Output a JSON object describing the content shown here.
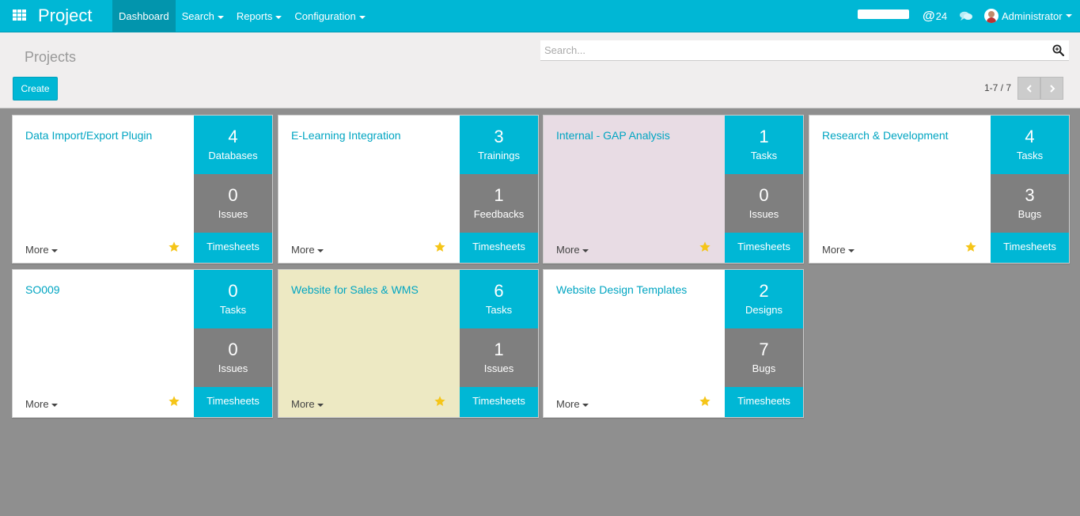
{
  "navbar": {
    "app_title": "Project",
    "menu": [
      {
        "label": "Dashboard",
        "dropdown": false,
        "active": true
      },
      {
        "label": "Search",
        "dropdown": true,
        "active": false
      },
      {
        "label": "Reports",
        "dropdown": true,
        "active": false
      },
      {
        "label": "Configuration",
        "dropdown": true,
        "active": false
      }
    ],
    "mentions_count": "24",
    "user_name": "Administrator"
  },
  "control_panel": {
    "breadcrumb": "Projects",
    "search_placeholder": "Search...",
    "create_label": "Create",
    "pager": "1-7 / 7"
  },
  "colors": {
    "brand": "#00b7d5",
    "secondary_stat": "#7f7f7f",
    "star": "#f5c518",
    "card_pink": "#e8dce4",
    "card_yellow": "#ede9c3"
  },
  "projects": [
    {
      "name": "Data Import/Export Plugin",
      "primary": {
        "value": "4",
        "label": "Databases"
      },
      "secondary": {
        "value": "0",
        "label": "Issues"
      },
      "more": "More",
      "timesheets": "Timesheets",
      "bg": "white"
    },
    {
      "name": "E-Learning Integration",
      "primary": {
        "value": "3",
        "label": "Trainings"
      },
      "secondary": {
        "value": "1",
        "label": "Feedbacks"
      },
      "more": "More",
      "timesheets": "Timesheets",
      "bg": "white"
    },
    {
      "name": "Internal - GAP Analysis",
      "primary": {
        "value": "1",
        "label": "Tasks"
      },
      "secondary": {
        "value": "0",
        "label": "Issues"
      },
      "more": "More",
      "timesheets": "Timesheets",
      "bg": "pink"
    },
    {
      "name": "Research & Development",
      "primary": {
        "value": "4",
        "label": "Tasks"
      },
      "secondary": {
        "value": "3",
        "label": "Bugs"
      },
      "more": "More",
      "timesheets": "Timesheets",
      "bg": "white"
    },
    {
      "name": "SO009",
      "primary": {
        "value": "0",
        "label": "Tasks"
      },
      "secondary": {
        "value": "0",
        "label": "Issues"
      },
      "more": "More",
      "timesheets": "Timesheets",
      "bg": "white"
    },
    {
      "name": "Website for Sales & WMS",
      "primary": {
        "value": "6",
        "label": "Tasks"
      },
      "secondary": {
        "value": "1",
        "label": "Issues"
      },
      "more": "More",
      "timesheets": "Timesheets",
      "bg": "yellow"
    },
    {
      "name": "Website Design Templates",
      "primary": {
        "value": "2",
        "label": "Designs"
      },
      "secondary": {
        "value": "7",
        "label": "Bugs"
      },
      "more": "More",
      "timesheets": "Timesheets",
      "bg": "white"
    }
  ]
}
